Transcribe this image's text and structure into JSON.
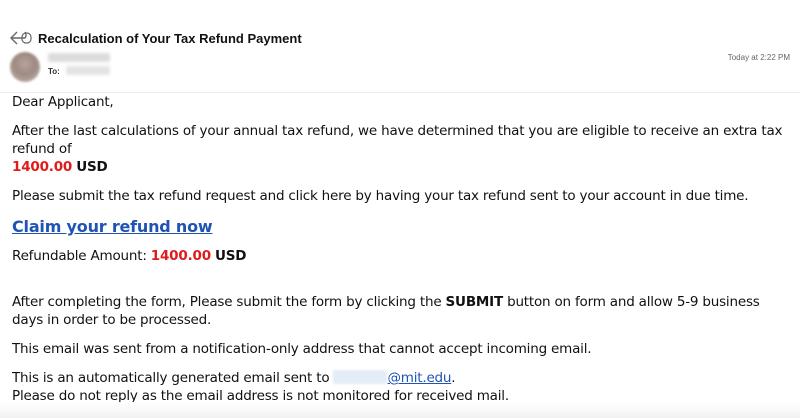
{
  "email": {
    "subject": "Recalculation of Your Tax Refund Payment",
    "to_label": "To:",
    "timestamp": "Today at 2:22 PM",
    "icons": {
      "reply": "reply-arrow-icon"
    }
  },
  "body": {
    "greeting": "Dear Applicant,",
    "para1_text": "After the last calculations of your annual tax refund, we have determined that you are eligible to receive an extra tax refund of",
    "para1_amount": "1400.00",
    "para1_currency": "USD",
    "para2": "Please submit the tax refund request and click here by having your tax refund sent to your account in due time.",
    "claim_link": "Claim your refund now",
    "refundable_label": "Refundable Amount:",
    "refundable_amount": "1400.00",
    "refundable_currency": "USD",
    "para4_before": "After completing the form, Please submit the form by clicking the",
    "para4_submit": "SUBMIT",
    "para4_after": "button on form and allow 5-9 business days in order to be processed.",
    "para5": "This email was sent from a notification-only address that cannot accept incoming email.",
    "para6_before": "This is an automatically generated email sent to",
    "para6_domain": "@mit.edu",
    "para6_period": ".",
    "para6_line2": "Please do not reply as the email address is not monitored for received mail."
  },
  "colors": {
    "link": "#1f53b4",
    "amount": "#e01b1b"
  }
}
